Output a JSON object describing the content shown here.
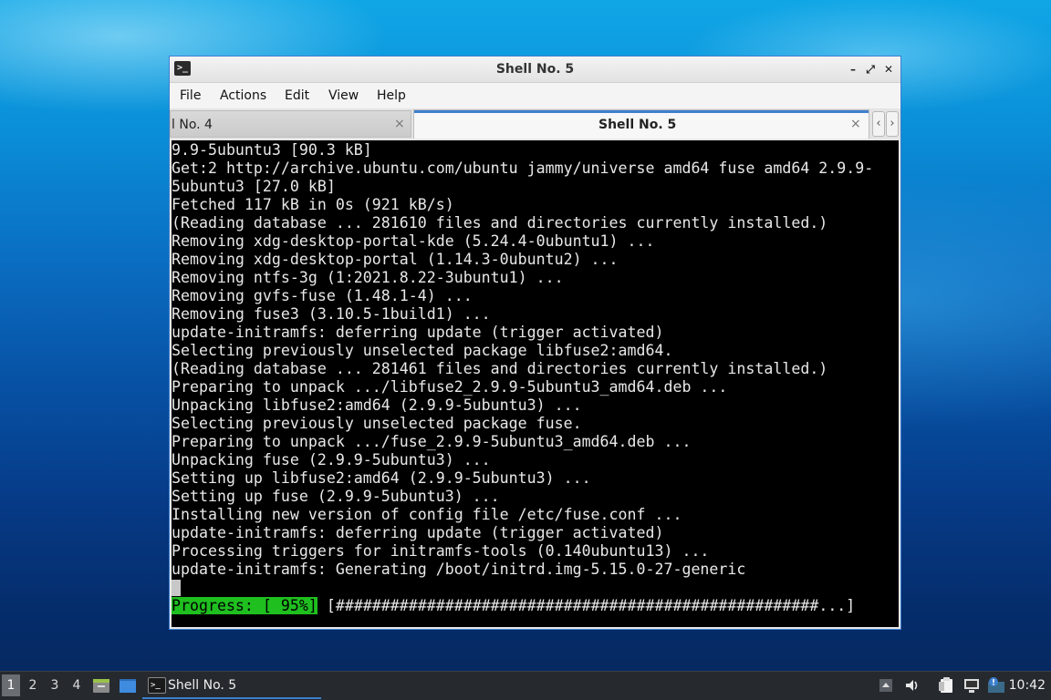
{
  "window": {
    "title": "Shell No. 5",
    "buttons": {
      "minimize": "–",
      "maximize": "⤢",
      "close": "✕"
    }
  },
  "menubar": {
    "items": [
      "File",
      "Actions",
      "Edit",
      "View",
      "Help"
    ]
  },
  "tabs": [
    {
      "label": "l No. 4",
      "close": "×"
    },
    {
      "label": "Shell No. 5",
      "close": "×"
    }
  ],
  "tab_scroll": {
    "left": "‹",
    "right": "›"
  },
  "terminal": {
    "lines": [
      "9.9-5ubuntu3 [90.3 kB]",
      "Get:2 http://archive.ubuntu.com/ubuntu jammy/universe amd64 fuse amd64 2.9.9-",
      "5ubuntu3 [27.0 kB]",
      "Fetched 117 kB in 0s (921 kB/s)",
      "(Reading database ... 281610 files and directories currently installed.)",
      "Removing xdg-desktop-portal-kde (5.24.4-0ubuntu1) ...",
      "Removing xdg-desktop-portal (1.14.3-0ubuntu2) ...",
      "Removing ntfs-3g (1:2021.8.22-3ubuntu1) ...",
      "Removing gvfs-fuse (1.48.1-4) ...",
      "Removing fuse3 (3.10.5-1build1) ...",
      "update-initramfs: deferring update (trigger activated)",
      "Selecting previously unselected package libfuse2:amd64.",
      "(Reading database ... 281461 files and directories currently installed.)",
      "Preparing to unpack .../libfuse2_2.9.9-5ubuntu3_amd64.deb ...",
      "Unpacking libfuse2:amd64 (2.9.9-5ubuntu3) ...",
      "Selecting previously unselected package fuse.",
      "Preparing to unpack .../fuse_2.9.9-5ubuntu3_amd64.deb ...",
      "Unpacking fuse (2.9.9-5ubuntu3) ...",
      "Setting up libfuse2:amd64 (2.9.9-5ubuntu3) ...",
      "Setting up fuse (2.9.9-5ubuntu3) ...",
      "Installing new version of config file /etc/fuse.conf ...",
      "update-initramfs: deferring update (trigger activated)",
      "Processing triggers for initramfs-tools (0.140ubuntu13) ...",
      "update-initramfs: Generating /boot/initrd.img-5.15.0-27-generic"
    ],
    "progress_label": "Progress: [ 95%]",
    "progress_bar": " [#####################################################...]",
    "progress_percent": 95
  },
  "taskbar": {
    "workspaces": [
      "1",
      "2",
      "3",
      "4"
    ],
    "active_workspace": "1",
    "task_label": "Shell No. 5",
    "clock": "10:42"
  }
}
